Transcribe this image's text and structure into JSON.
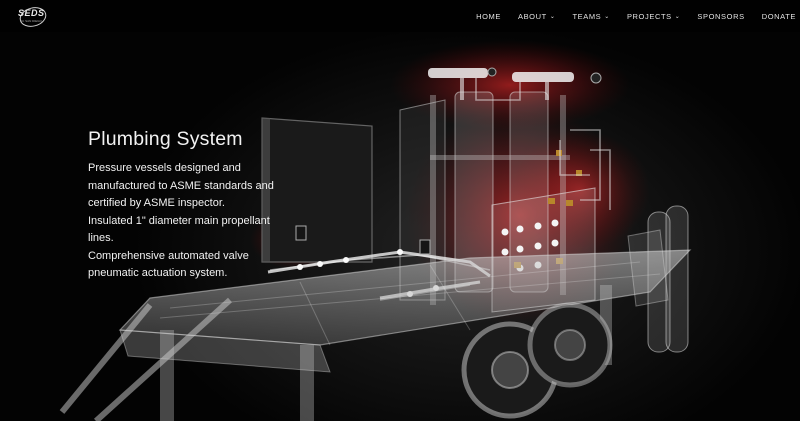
{
  "logo": {
    "text": "SEDS",
    "subtext": "UC SAN DIEGO"
  },
  "nav": {
    "items": [
      {
        "label": "HOME",
        "dropdown": false
      },
      {
        "label": "ABOUT",
        "dropdown": true
      },
      {
        "label": "TEAMS",
        "dropdown": true
      },
      {
        "label": "PROJECTS",
        "dropdown": true
      },
      {
        "label": "SPONSORS",
        "dropdown": false
      },
      {
        "label": "DONATE",
        "dropdown": false
      }
    ]
  },
  "hero": {
    "title": "Plumbing System",
    "lines": [
      "Pressure vessels designed and",
      "manufactured to ASME standards and",
      "certified by ASME inspector.",
      "Insulated 1\" diameter main propellant",
      "lines.",
      "Comprehensive automated valve",
      "pneumatic actuation system."
    ]
  },
  "colors": {
    "accent_glow": "#ff2a2a",
    "background": "#000000",
    "text": "#f2f2f2"
  }
}
